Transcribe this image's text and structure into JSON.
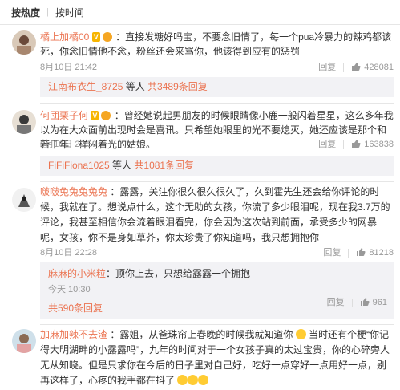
{
  "tabs": {
    "hot": "按热度",
    "time": "按时间"
  },
  "comments": [
    {
      "user": "橘上加橘00",
      "text": "：直接发糖好吗宝，不要念旧情了，每一个pua冷暴力的辣鸡都该死，你念旧情他不念，粉丝还会来骂你，他该得到应有的惩罚",
      "time": "8月10日 21:42",
      "reply": "回复",
      "likes": "428081",
      "sub_user": "江南布衣生_8725",
      "sub_mid": " 等人 ",
      "sub_count": "共3489条回复"
    },
    {
      "user": "何団栗子何",
      "text": "：曾经她说起男朋友的时候眼睛像小鹿一般闪着星星，这么多年我以为在大众面前出现时会是喜讯。只希望她眼里的光不要熄灭，她还应该是那个和若干年一样闪着光的姑娘。",
      "time": "8月10日 22:59",
      "reply": "回复",
      "likes": "163838",
      "sub_user": "FiFiFiona1025",
      "sub_mid": " 等人 ",
      "sub_count": "共1081条回复"
    },
    {
      "user": "啵啵兔兔兔兔兔",
      "text": "：露露，关注你很久很久很久了，久到霍先生还会给你评论的时候，我就在了。想说点什么，这个无助的女孩，你流了多少眼泪呢，现在我3.7万的评论，我甚至相信你会流着眼泪看完，你会因为这次站到前面，承受多少的网暴呢，女孩，你不是身如草芥，你太珍贵了你知道吗，我只想拥抱你",
      "time": "8月10日 22:28",
      "reply": "回复",
      "likes": "81218",
      "inner": {
        "user": "麻麻的小米粒",
        "text": "：顶你上去，只想给露露一个拥抱",
        "time": "今天 10:30",
        "reply": "回复",
        "likes": "961"
      },
      "sub_count": "共590条回复"
    },
    {
      "user": "加麻加辣不去渣",
      "text_a": "：露姐，从爸珠帘上春晚的时候我就知道你",
      "text_b": "当时还有个梗“你记得大明湖畔的小露露吗”，九年的时间对于一个女孩子真的太过宝贵，你的心碎旁人无从知晓。但是只求你在今后的日子里对自己好，吃好一点穿好一点用好一点，别再这样了，心疼的我手都在抖了"
    }
  ],
  "colors": {
    "accent": "#eb7350",
    "sub_bg": "#f2f2f5",
    "meta": "#999999"
  }
}
